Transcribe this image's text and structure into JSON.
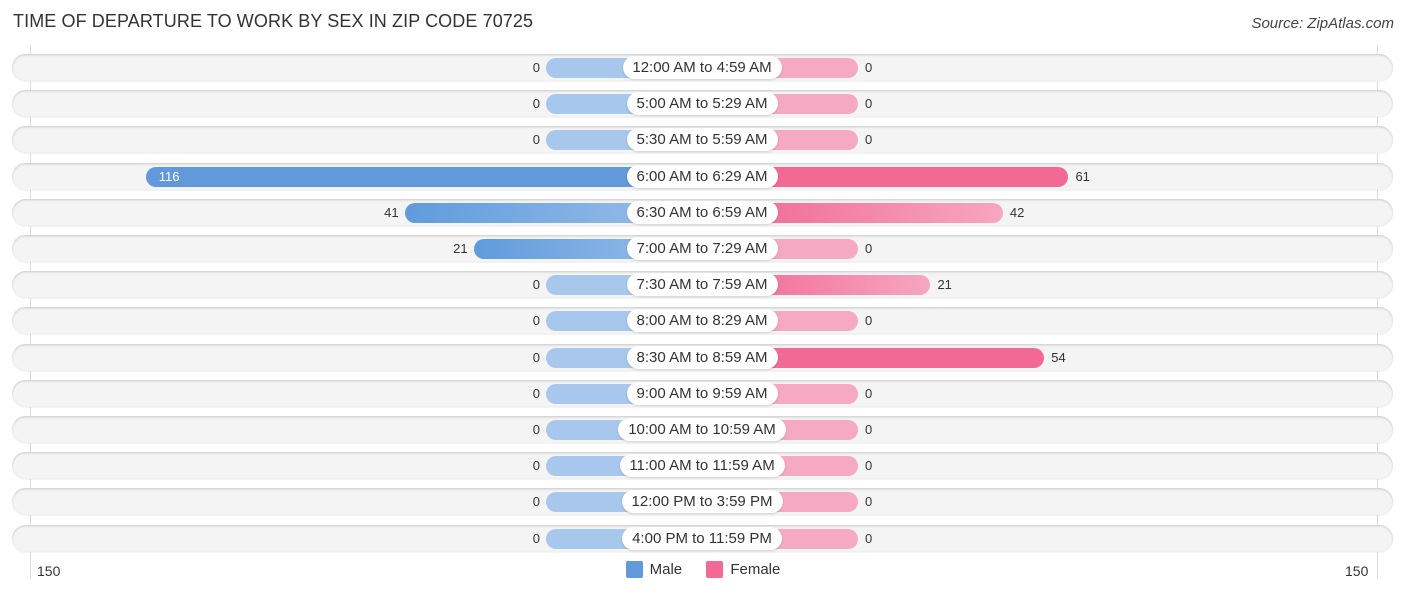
{
  "title": "TIME OF DEPARTURE TO WORK BY SEX IN ZIP CODE 70725",
  "source": "Source: ZipAtlas.com",
  "colors": {
    "male": "#6199da",
    "female": "#f26a94"
  },
  "chart_data": {
    "type": "bar",
    "orientation": "horizontal-diverging",
    "title": "TIME OF DEPARTURE TO WORK BY SEX IN ZIP CODE 70725",
    "categories": [
      "12:00 AM to 4:59 AM",
      "5:00 AM to 5:29 AM",
      "5:30 AM to 5:59 AM",
      "6:00 AM to 6:29 AM",
      "6:30 AM to 6:59 AM",
      "7:00 AM to 7:29 AM",
      "7:30 AM to 7:59 AM",
      "8:00 AM to 8:29 AM",
      "8:30 AM to 8:59 AM",
      "9:00 AM to 9:59 AM",
      "10:00 AM to 10:59 AM",
      "11:00 AM to 11:59 AM",
      "12:00 PM to 3:59 PM",
      "4:00 PM to 11:59 PM"
    ],
    "series": [
      {
        "name": "Male",
        "values": [
          0,
          0,
          0,
          116,
          41,
          21,
          0,
          0,
          0,
          0,
          0,
          0,
          0,
          0
        ]
      },
      {
        "name": "Female",
        "values": [
          0,
          0,
          0,
          61,
          42,
          0,
          21,
          0,
          54,
          0,
          0,
          0,
          0,
          0
        ]
      }
    ],
    "axis": {
      "left_label": "150",
      "right_label": "150",
      "range": [
        -150,
        150
      ]
    },
    "legend": {
      "placement": "bottom-center",
      "entries": [
        "Male",
        "Female"
      ]
    },
    "xlabel": "",
    "ylabel": ""
  }
}
